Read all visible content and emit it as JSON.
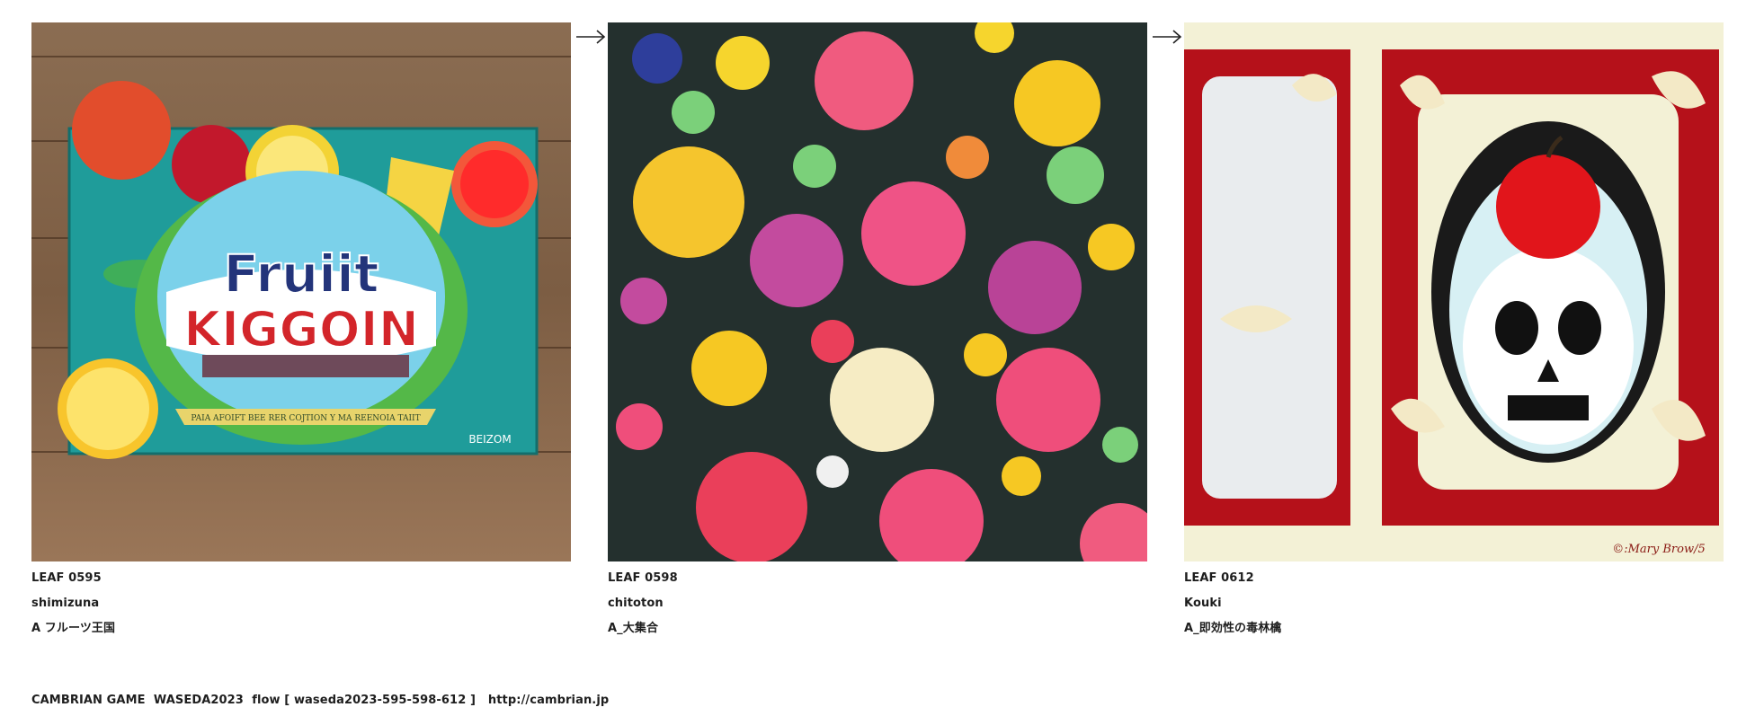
{
  "leaves": [
    {
      "id": "LEAF 0595",
      "author": "shimizuna",
      "title": "A フルーツ王国",
      "art_text": {
        "line1": "Fruiit",
        "line2": "KIGGOIN",
        "ribbon": "PAIA AFOIFT BEE RER COJTION Y MA REENOIA TAIIT",
        "badge": "BEIZOM"
      }
    },
    {
      "id": "LEAF 0598",
      "author": "chitoton",
      "title": "A_大集合"
    },
    {
      "id": "LEAF 0612",
      "author": "Kouki",
      "title": "A_即効性の毒林檎",
      "art_text": {
        "signature": "©:Mary Brow/5"
      }
    }
  ],
  "arrow_glyph": "→",
  "footer": {
    "text": "CAMBRIAN GAME  WASEDA2023  flow [ waseda2023-595-598-612 ]   http://cambrian.jp"
  },
  "colors": {
    "text": "#1e1e1e",
    "wood": "#8a6a4e",
    "box": "#1f9c9a",
    "dark_bg": "#24302e",
    "poster_red": "#b5111a",
    "poster_cream": "#f3f1d6"
  }
}
